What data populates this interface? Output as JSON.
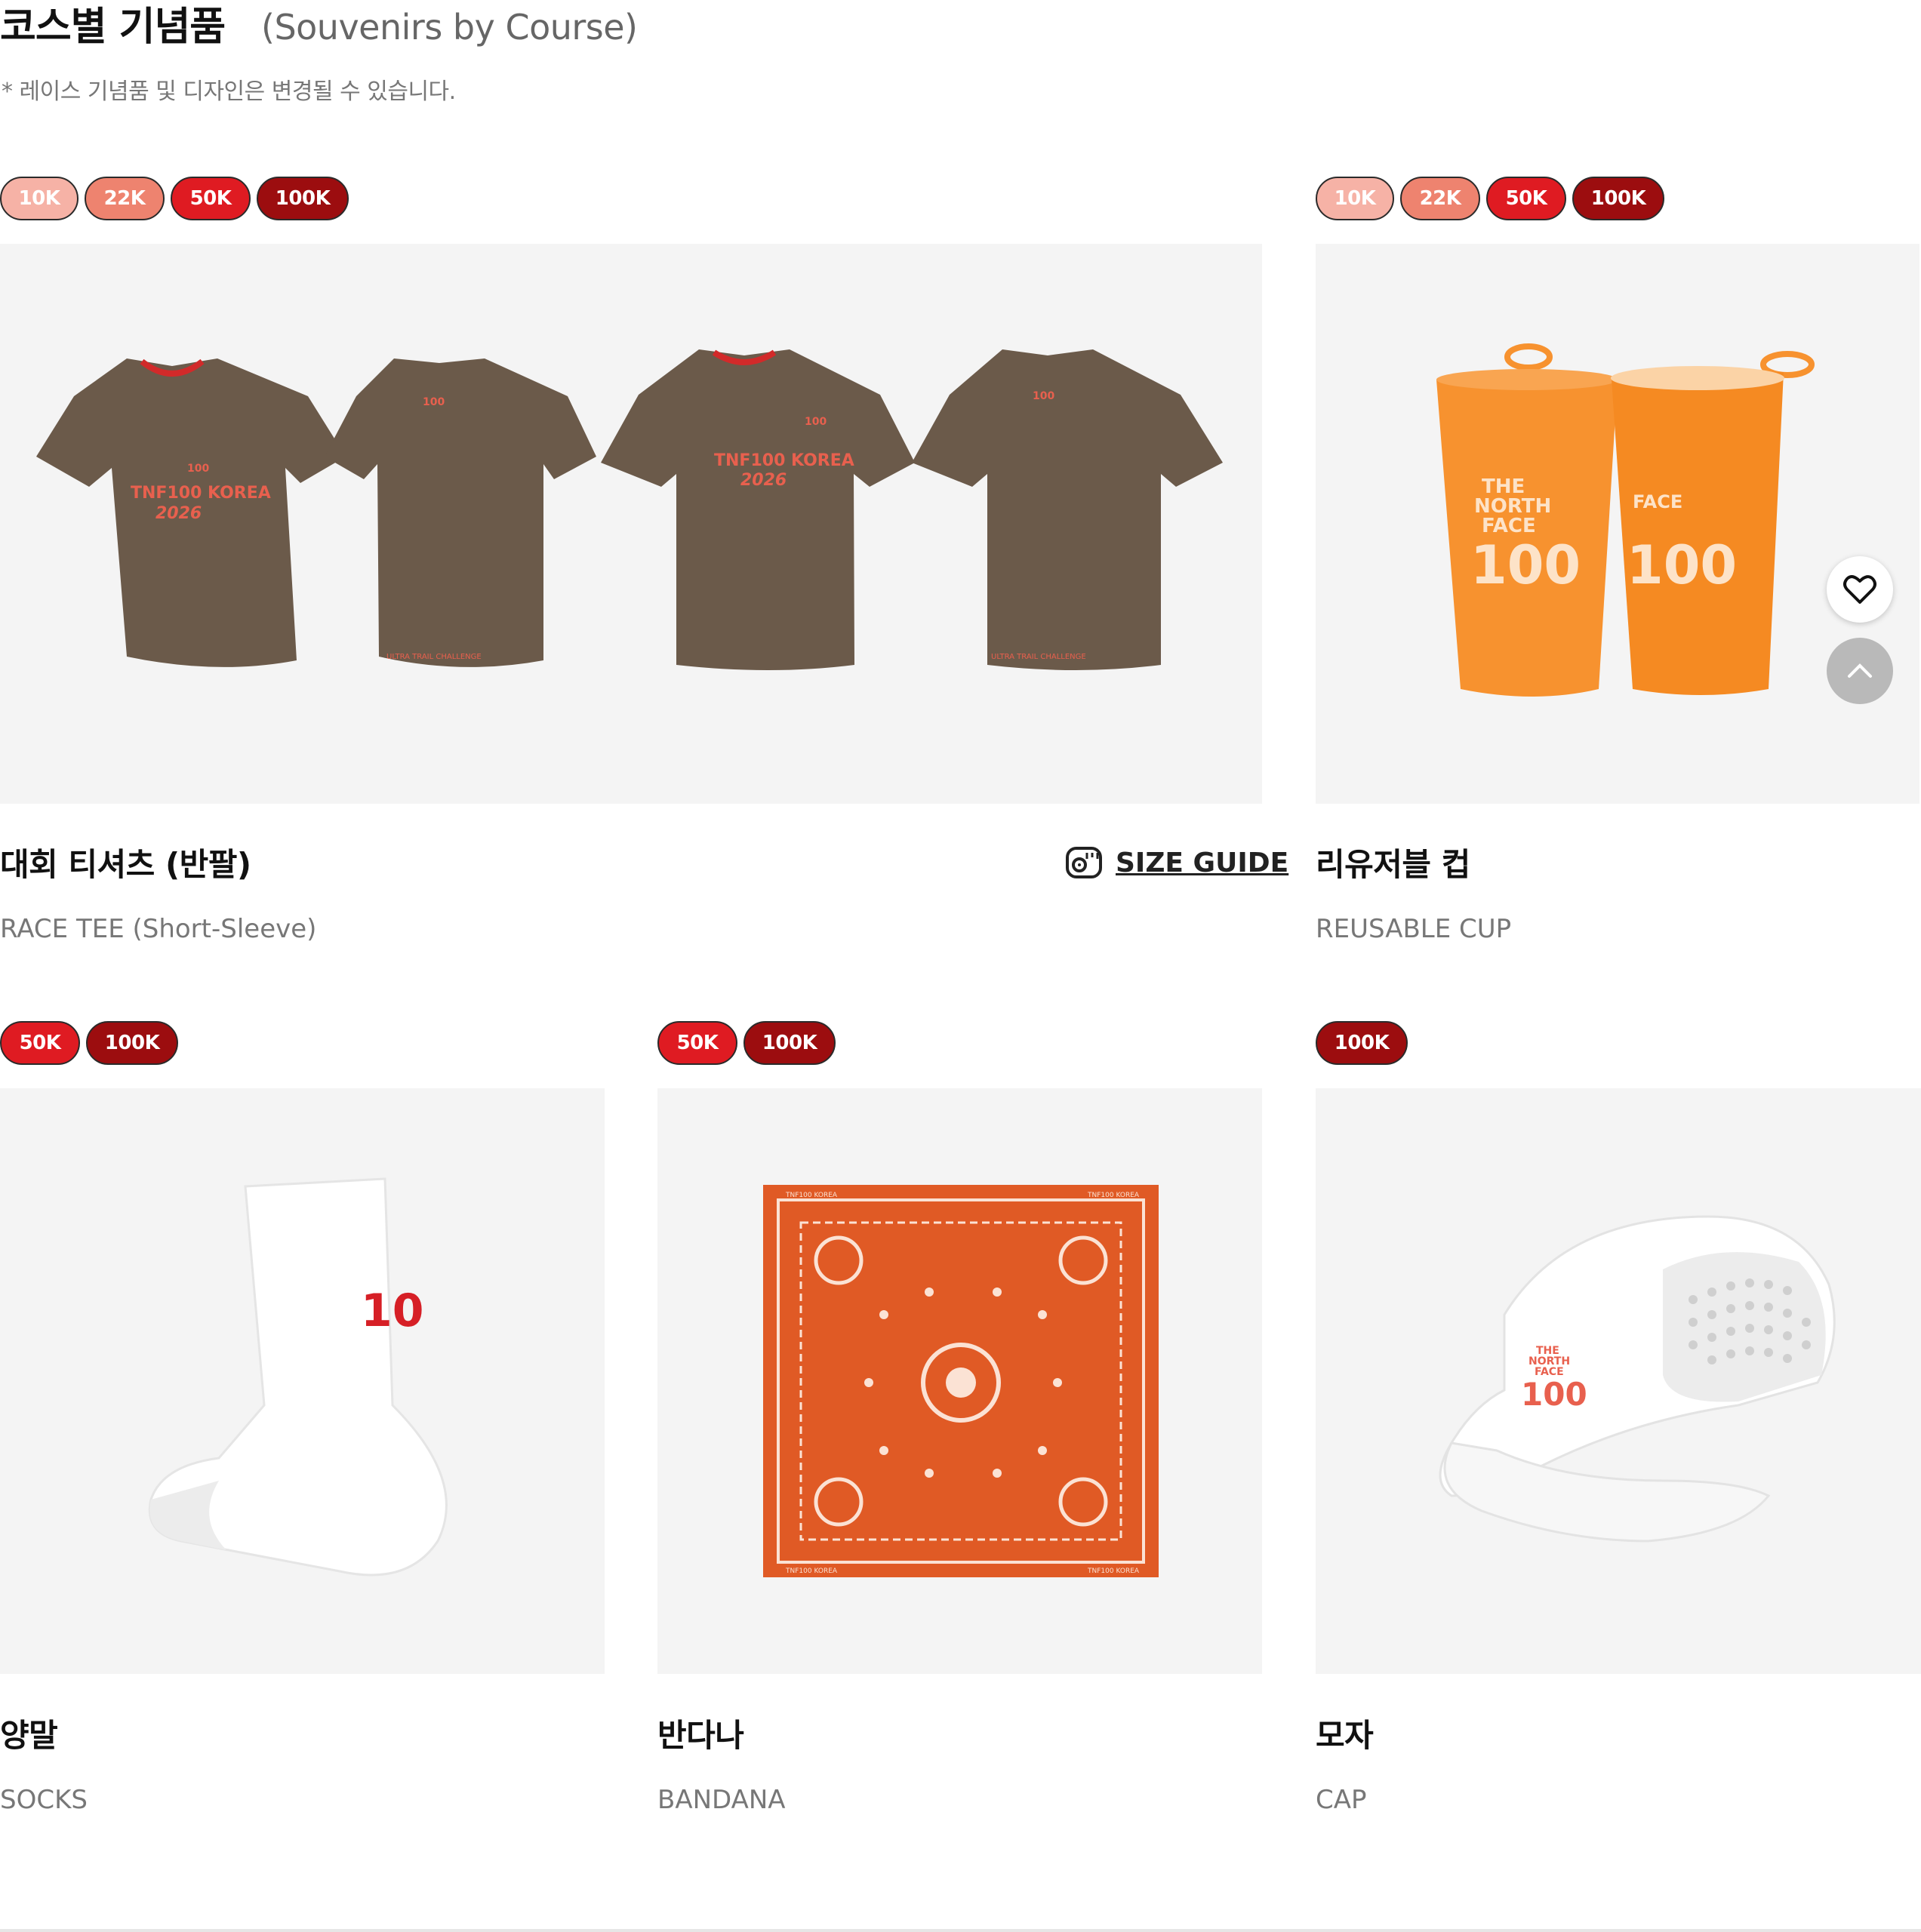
{
  "header": {
    "title": "코스별 기념품",
    "subtitle": "(Souvenirs by Course)",
    "note": "* 레이스 기념품 및 디자인은 변경될 수 있습니다."
  },
  "badges": {
    "k10": "10K",
    "k22": "22K",
    "k50": "50K",
    "k100": "100K"
  },
  "products": {
    "tee": {
      "name_ko": "대회 티셔츠 (반팔)",
      "name_en": "RACE TEE (Short-Sleeve)",
      "size_guide": "SIZE GUIDE",
      "print_text": "TNF100 KOREA",
      "print_year": "2026",
      "back_text": "ULTRA TRAIL CHALLENGE",
      "logo_num": "100"
    },
    "cup": {
      "name_ko": "리유저블 컵",
      "name_en": "REUSABLE CUP",
      "logo_lines": [
        "THE",
        "NORTH",
        "FACE"
      ],
      "logo_num": "100"
    },
    "socks": {
      "name_ko": "양말",
      "name_en": "SOCKS",
      "logo_num": "10"
    },
    "bandana": {
      "name_ko": "반다나",
      "name_en": "BANDANA",
      "border_text": "TNF100 KOREA"
    },
    "cap": {
      "name_ko": "모자",
      "name_en": "CAP",
      "logo_lines": [
        "THE",
        "NORTH",
        "FACE"
      ],
      "logo_num": "100"
    }
  },
  "colors": {
    "badge_10k": "#f6b2a6",
    "badge_22k": "#ee836f",
    "badge_50k": "#df1b22",
    "badge_100k": "#9c0d0f",
    "tee": "#6b5a4a",
    "print": "#e8604e",
    "cup": "#f7922f",
    "bandana": "#e05a25"
  }
}
